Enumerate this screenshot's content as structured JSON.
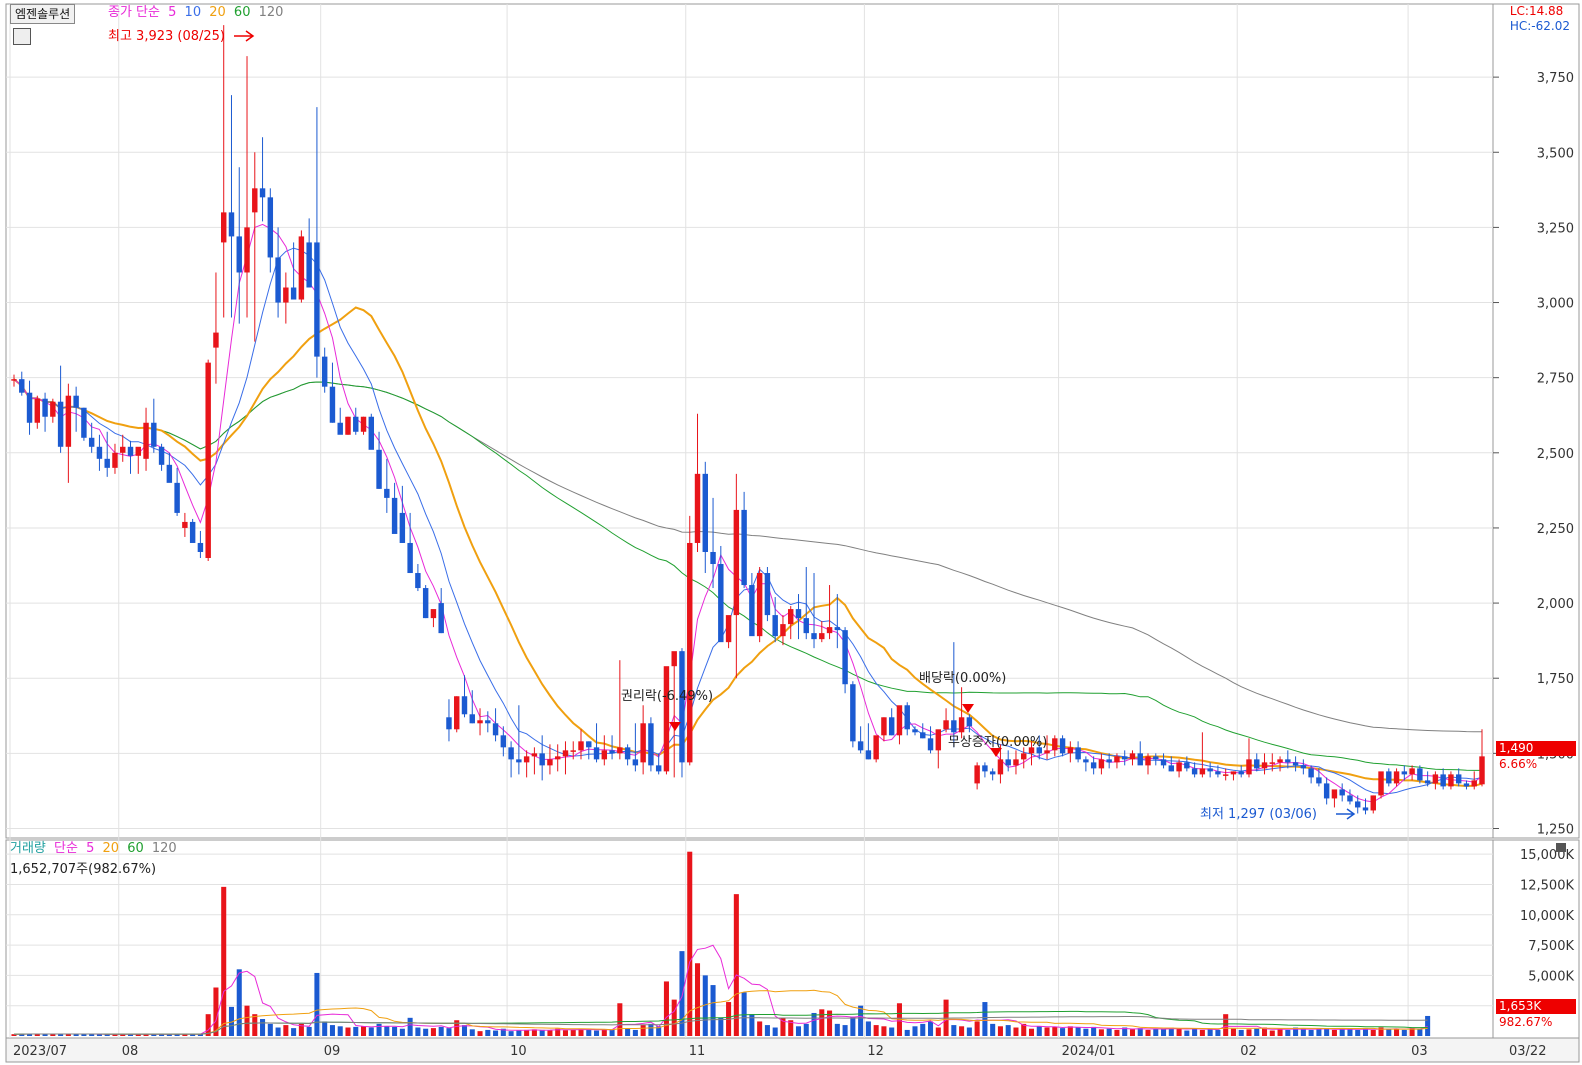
{
  "stock": {
    "name": "엠젠솔루션",
    "price_legend_label": "종가 단순",
    "price_ma_periods": [
      "5",
      "10",
      "20",
      "60",
      "120"
    ],
    "volume_legend_label": "거래량",
    "volume_ma_label": "단순",
    "volume_ma_periods": [
      "5",
      "20",
      "60",
      "120"
    ],
    "volume_summary": "1,652,707주(982.67%)",
    "lc_label": "LC:14.88",
    "hc_label": "HC:-62.02",
    "current_price": "1,490",
    "current_change": "6.66%",
    "current_volume": "1,653K",
    "current_volume_pct": "982.67%"
  },
  "annotations": {
    "high": "최고 3,923 (08/25)",
    "low": "최저 1,297 (03/06)",
    "rights": "권리락(-6.49%)",
    "dividend": "배당락(0.00%)",
    "free_issue": "무상증자(0.00%)"
  },
  "colors": {
    "up": "#e8141a",
    "down": "#1b5ad1",
    "ma5": "#e82ad8",
    "ma10": "#3a6ee8",
    "ma20": "#f0a010",
    "ma60": "#20a030",
    "ma120": "#808080"
  },
  "chart_data": {
    "type": "candlestick",
    "price_axis": {
      "ticks": [
        "3,750",
        "3,500",
        "3,250",
        "3,000",
        "2,750",
        "2,500",
        "2,250",
        "2,000",
        "1,750",
        "1,500",
        "1,250"
      ],
      "range": [
        1225,
        3980
      ]
    },
    "volume_axis": {
      "ticks": [
        "15,000K",
        "12,500K",
        "10,000K",
        "7,500K",
        "5,000K",
        "2,500K"
      ],
      "range": [
        0,
        16000
      ]
    },
    "x_labels": [
      "2023/07",
      "08",
      "09",
      "10",
      "11",
      "12",
      "2024/01",
      "02",
      "03",
      "03/22"
    ],
    "x_label_index": [
      0,
      14,
      40,
      64,
      87,
      110,
      135,
      158,
      180,
      199
    ],
    "candles": [
      [
        2740,
        2760,
        2720,
        2745
      ],
      [
        2745,
        2770,
        2690,
        2700
      ],
      [
        2700,
        2740,
        2560,
        2600
      ],
      [
        2600,
        2690,
        2580,
        2680
      ],
      [
        2680,
        2700,
        2570,
        2620
      ],
      [
        2620,
        2680,
        2600,
        2670
      ],
      [
        2670,
        2790,
        2500,
        2520
      ],
      [
        2520,
        2730,
        2400,
        2690
      ],
      [
        2690,
        2720,
        2570,
        2650
      ],
      [
        2650,
        2650,
        2540,
        2550
      ],
      [
        2550,
        2600,
        2500,
        2520
      ],
      [
        2520,
        2560,
        2440,
        2480
      ],
      [
        2480,
        2570,
        2420,
        2450
      ],
      [
        2450,
        2530,
        2430,
        2500
      ],
      [
        2500,
        2560,
        2470,
        2520
      ],
      [
        2520,
        2540,
        2430,
        2490
      ],
      [
        2490,
        2510,
        2430,
        2520
      ],
      [
        2480,
        2650,
        2440,
        2600
      ],
      [
        2600,
        2680,
        2500,
        2520
      ],
      [
        2520,
        2530,
        2440,
        2460
      ],
      [
        2460,
        2500,
        2410,
        2400
      ],
      [
        2400,
        2450,
        2290,
        2300
      ],
      [
        2250,
        2300,
        2220,
        2270
      ],
      [
        2270,
        2280,
        2220,
        2200
      ],
      [
        2200,
        2240,
        2150,
        2170
      ],
      [
        2150,
        2810,
        2140,
        2800
      ],
      [
        2850,
        3100,
        2730,
        2900
      ],
      [
        3200,
        3923,
        2950,
        3300
      ],
      [
        3300,
        3690,
        2950,
        3220
      ],
      [
        3220,
        3450,
        2930,
        3100
      ],
      [
        3100,
        3820,
        2950,
        3250
      ],
      [
        3300,
        3500,
        2870,
        3380
      ],
      [
        3380,
        3550,
        3270,
        3350
      ],
      [
        3350,
        3380,
        3100,
        3150
      ],
      [
        3150,
        3250,
        2950,
        3000
      ],
      [
        3000,
        3100,
        2930,
        3050
      ],
      [
        3050,
        3200,
        3020,
        3010
      ],
      [
        3010,
        3240,
        3000,
        3220
      ],
      [
        3200,
        3280,
        3050,
        3050
      ],
      [
        3200,
        3650,
        2750,
        2820
      ],
      [
        2820,
        2850,
        2700,
        2720
      ],
      [
        2720,
        2800,
        2600,
        2600
      ],
      [
        2600,
        2650,
        2570,
        2560
      ],
      [
        2560,
        2620,
        2560,
        2620
      ],
      [
        2620,
        2650,
        2560,
        2570
      ],
      [
        2570,
        2620,
        2560,
        2620
      ],
      [
        2620,
        2630,
        2560,
        2510
      ],
      [
        2510,
        2570,
        2380,
        2380
      ],
      [
        2380,
        2480,
        2300,
        2350
      ],
      [
        2350,
        2400,
        2240,
        2230
      ],
      [
        2300,
        2390,
        2200,
        2200
      ],
      [
        2200,
        2300,
        2100,
        2100
      ],
      [
        2100,
        2130,
        2040,
        2050
      ],
      [
        2050,
        2060,
        1950,
        1950
      ],
      [
        1950,
        1970,
        1920,
        1980
      ],
      [
        2000,
        2050,
        1900,
        1900
      ],
      [
        1620,
        1680,
        1540,
        1580
      ],
      [
        1580,
        1690,
        1570,
        1690
      ],
      [
        1690,
        1760,
        1620,
        1630
      ],
      [
        1630,
        1710,
        1600,
        1600
      ],
      [
        1600,
        1650,
        1560,
        1610
      ],
      [
        1610,
        1640,
        1570,
        1600
      ],
      [
        1600,
        1650,
        1540,
        1560
      ],
      [
        1560,
        1590,
        1490,
        1520
      ],
      [
        1520,
        1540,
        1420,
        1480
      ],
      [
        1480,
        1660,
        1430,
        1470
      ],
      [
        1470,
        1510,
        1420,
        1490
      ],
      [
        1490,
        1520,
        1430,
        1500
      ],
      [
        1500,
        1560,
        1410,
        1460
      ],
      [
        1460,
        1530,
        1430,
        1480
      ],
      [
        1480,
        1530,
        1440,
        1490
      ],
      [
        1490,
        1540,
        1430,
        1510
      ],
      [
        1510,
        1540,
        1480,
        1510
      ],
      [
        1510,
        1580,
        1480,
        1540
      ],
      [
        1540,
        1540,
        1480,
        1520
      ],
      [
        1520,
        1600,
        1470,
        1480
      ],
      [
        1480,
        1560,
        1460,
        1510
      ],
      [
        1510,
        1560,
        1480,
        1500
      ],
      [
        1500,
        1810,
        1480,
        1520
      ],
      [
        1520,
        1530,
        1460,
        1480
      ],
      [
        1480,
        1600,
        1440,
        1460
      ],
      [
        1470,
        1660,
        1430,
        1600
      ],
      [
        1600,
        1620,
        1440,
        1460
      ],
      [
        1460,
        1500,
        1430,
        1440
      ],
      [
        1440,
        1740,
        1430,
        1790
      ],
      [
        1790,
        1810,
        1420,
        1840
      ],
      [
        1840,
        1850,
        1420,
        1470
      ],
      [
        1470,
        2290,
        1460,
        2200
      ],
      [
        2200,
        2630,
        2170,
        2430
      ],
      [
        2430,
        2470,
        2100,
        2170
      ],
      [
        2170,
        2350,
        2050,
        2130
      ],
      [
        2130,
        2190,
        1940,
        1870
      ],
      [
        1870,
        1930,
        1850,
        1960
      ],
      [
        1960,
        2430,
        1750,
        2310
      ],
      [
        2310,
        2370,
        2050,
        2060
      ],
      [
        2060,
        2100,
        1900,
        1890
      ],
      [
        1890,
        2120,
        1870,
        2100
      ],
      [
        2100,
        2120,
        1940,
        1960
      ],
      [
        1960,
        2020,
        1870,
        1890
      ],
      [
        1890,
        1960,
        1860,
        1930
      ],
      [
        1930,
        1990,
        1880,
        1980
      ],
      [
        1980,
        2030,
        1880,
        1950
      ],
      [
        1950,
        2120,
        1880,
        1900
      ],
      [
        1900,
        2100,
        1850,
        1880
      ],
      [
        1880,
        1940,
        1870,
        1900
      ],
      [
        1900,
        2060,
        1880,
        1920
      ],
      [
        1920,
        2030,
        1850,
        1910
      ],
      [
        1910,
        1920,
        1700,
        1730
      ],
      [
        1730,
        1740,
        1520,
        1540
      ],
      [
        1540,
        1590,
        1500,
        1510
      ],
      [
        1510,
        1600,
        1480,
        1480
      ],
      [
        1480,
        1540,
        1470,
        1560
      ],
      [
        1560,
        1620,
        1540,
        1620
      ],
      [
        1620,
        1650,
        1560,
        1560
      ],
      [
        1560,
        1650,
        1530,
        1660
      ],
      [
        1660,
        1670,
        1560,
        1580
      ],
      [
        1580,
        1590,
        1560,
        1570
      ],
      [
        1570,
        1600,
        1550,
        1550
      ],
      [
        1550,
        1590,
        1500,
        1510
      ],
      [
        1510,
        1530,
        1450,
        1580
      ],
      [
        1580,
        1650,
        1570,
        1610
      ],
      [
        1610,
        1870,
        1520,
        1570
      ],
      [
        1570,
        1720,
        1550,
        1620
      ],
      [
        1620,
        1630,
        1570,
        1590
      ],
      [
        1400,
        1470,
        1380,
        1460
      ],
      [
        1460,
        1470,
        1420,
        1440
      ],
      [
        1440,
        1450,
        1410,
        1430
      ],
      [
        1430,
        1530,
        1400,
        1480
      ],
      [
        1480,
        1510,
        1440,
        1460
      ],
      [
        1460,
        1510,
        1430,
        1480
      ],
      [
        1480,
        1520,
        1450,
        1500
      ],
      [
        1500,
        1540,
        1460,
        1520
      ],
      [
        1520,
        1560,
        1480,
        1500
      ],
      [
        1500,
        1560,
        1480,
        1510
      ],
      [
        1510,
        1560,
        1490,
        1550
      ],
      [
        1550,
        1560,
        1490,
        1500
      ],
      [
        1500,
        1540,
        1470,
        1520
      ],
      [
        1520,
        1540,
        1470,
        1480
      ],
      [
        1480,
        1490,
        1440,
        1470
      ],
      [
        1470,
        1490,
        1430,
        1450
      ],
      [
        1450,
        1500,
        1430,
        1480
      ],
      [
        1480,
        1500,
        1450,
        1470
      ],
      [
        1470,
        1500,
        1450,
        1490
      ],
      [
        1490,
        1510,
        1460,
        1480
      ],
      [
        1480,
        1510,
        1460,
        1500
      ],
      [
        1500,
        1540,
        1470,
        1460
      ],
      [
        1460,
        1500,
        1430,
        1490
      ],
      [
        1490,
        1500,
        1460,
        1480
      ],
      [
        1480,
        1500,
        1450,
        1460
      ],
      [
        1460,
        1490,
        1440,
        1440
      ],
      [
        1440,
        1480,
        1420,
        1470
      ],
      [
        1470,
        1490,
        1440,
        1450
      ],
      [
        1450,
        1470,
        1420,
        1430
      ],
      [
        1430,
        1570,
        1420,
        1450
      ],
      [
        1450,
        1470,
        1420,
        1440
      ],
      [
        1440,
        1460,
        1420,
        1430
      ],
      [
        1430,
        1450,
        1410,
        1430
      ],
      [
        1430,
        1440,
        1410,
        1440
      ],
      [
        1440,
        1460,
        1420,
        1430
      ],
      [
        1430,
        1550,
        1420,
        1480
      ],
      [
        1480,
        1500,
        1440,
        1450
      ],
      [
        1450,
        1500,
        1430,
        1470
      ],
      [
        1470,
        1500,
        1440,
        1470
      ],
      [
        1470,
        1490,
        1440,
        1480
      ],
      [
        1480,
        1510,
        1450,
        1470
      ],
      [
        1470,
        1490,
        1440,
        1460
      ],
      [
        1460,
        1480,
        1430,
        1450
      ],
      [
        1450,
        1460,
        1400,
        1420
      ],
      [
        1420,
        1450,
        1390,
        1400
      ],
      [
        1400,
        1420,
        1330,
        1350
      ],
      [
        1350,
        1370,
        1320,
        1380
      ],
      [
        1380,
        1400,
        1340,
        1360
      ],
      [
        1360,
        1380,
        1330,
        1340
      ],
      [
        1340,
        1360,
        1300,
        1320
      ],
      [
        1320,
        1350,
        1297,
        1310
      ],
      [
        1310,
        1360,
        1300,
        1360
      ],
      [
        1360,
        1420,
        1350,
        1440
      ],
      [
        1440,
        1450,
        1390,
        1400
      ],
      [
        1400,
        1450,
        1390,
        1440
      ],
      [
        1440,
        1460,
        1410,
        1430
      ],
      [
        1430,
        1460,
        1410,
        1450
      ],
      [
        1450,
        1460,
        1400,
        1410
      ],
      [
        1410,
        1440,
        1390,
        1400
      ],
      [
        1400,
        1440,
        1380,
        1430
      ],
      [
        1430,
        1450,
        1380,
        1390
      ],
      [
        1390,
        1440,
        1380,
        1430
      ],
      [
        1430,
        1450,
        1390,
        1400
      ],
      [
        1400,
        1410,
        1380,
        1390
      ],
      [
        1390,
        1440,
        1380,
        1410
      ],
      [
        1397,
        1580,
        1390,
        1490
      ]
    ],
    "volumes_k": [
      150,
      170,
      180,
      160,
      170,
      140,
      160,
      200,
      150,
      160,
      140,
      150,
      140,
      130,
      150,
      140,
      130,
      160,
      170,
      150,
      140,
      160,
      170,
      150,
      140,
      1800,
      4000,
      12300,
      2400,
      5500,
      2500,
      1800,
      1400,
      1000,
      700,
      900,
      650,
      1000,
      750,
      5200,
      1200,
      900,
      800,
      700,
      750,
      800,
      700,
      1000,
      800,
      750,
      600,
      1500,
      700,
      600,
      650,
      750,
      650,
      1300,
      900,
      550,
      400,
      500,
      450,
      600,
      400,
      450,
      500,
      550,
      500,
      450,
      600,
      480,
      520,
      600,
      500,
      450,
      550,
      500,
      2700,
      600,
      500,
      900,
      1000,
      800,
      4500,
      3000,
      7000,
      15200,
      6000,
      5000,
      4200,
      1500,
      2800,
      11700,
      3600,
      1800,
      1200,
      900,
      700,
      1500,
      1300,
      800,
      1000,
      1900,
      2200,
      2100,
      1000,
      900,
      1600,
      2500,
      1200,
      900,
      800,
      700,
      2700,
      500,
      800,
      1000,
      1200,
      700,
      3000,
      900,
      800,
      700,
      1200,
      2800,
      1000,
      800,
      900,
      700,
      1000,
      600,
      800,
      700,
      750,
      650,
      800,
      700,
      600,
      750,
      550,
      600,
      500,
      700,
      550,
      650,
      500,
      600,
      550,
      700,
      600,
      450,
      650,
      500,
      550,
      500,
      1800,
      600,
      500,
      550,
      600,
      700,
      450,
      550,
      500,
      700,
      600,
      500,
      550,
      600,
      500,
      650,
      550,
      500,
      600,
      500,
      700,
      550,
      600,
      500,
      650,
      550,
      1653
    ]
  }
}
